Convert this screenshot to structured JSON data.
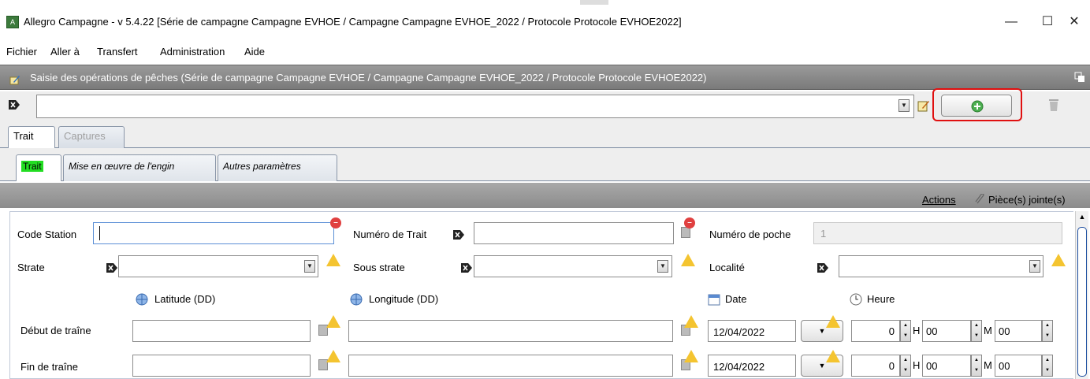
{
  "window": {
    "title": "Allegro Campagne - v 5.4.22 [Série de campagne Campagne EVHOE / Campagne Campagne EVHOE_2022 / Protocole Protocole EVHOE2022]",
    "app_icon_text": "A",
    "minimize": "—",
    "maximize": "☐",
    "close": "✕"
  },
  "menu": [
    "Fichier",
    "Aller à",
    "Transfert",
    "Administration",
    "Aide"
  ],
  "frame": {
    "title": "Saisie des opérations de pêches (Série de campagne Campagne EVHOE / Campagne Campagne EVHOE_2022 / Protocole Protocole EVHOE2022)"
  },
  "selector": {
    "value": "",
    "add_button_icon": "plus-circle-icon",
    "delete_button_icon": "trash-icon"
  },
  "tabs": [
    {
      "label": "Trait",
      "active": true
    },
    {
      "label": "Captures",
      "active": false,
      "disabled": true
    }
  ],
  "subtabs": [
    {
      "label": "Trait",
      "active": true,
      "highlight": "#22dd22"
    },
    {
      "label": "Mise en œuvre de l'engin"
    },
    {
      "label": "Autres paramètres"
    }
  ],
  "actions": {
    "actions_label": "Actions",
    "attachments_label": "Pièce(s) jointe(s)"
  },
  "form": {
    "code_station_label": "Code Station",
    "code_station_value": "",
    "numero_trait_label": "Numéro de Trait",
    "numero_trait_value": "",
    "numero_poche_label": "Numéro de poche",
    "numero_poche_value": "1",
    "strate_label": "Strate",
    "sous_strate_label": "Sous strate",
    "localite_label": "Localité",
    "latitude_label": "Latitude (DD)",
    "longitude_label": "Longitude (DD)",
    "date_label": "Date",
    "heure_label": "Heure",
    "rows": [
      {
        "label": "Début de traîne",
        "latitude": "",
        "longitude": "",
        "date": "12/04/2022",
        "hour": "0",
        "minute": "00",
        "second": "00"
      },
      {
        "label": "Fin de traîne",
        "latitude": "",
        "longitude": "",
        "date": "12/04/2022",
        "hour": "0",
        "minute": "00",
        "second": "00"
      }
    ],
    "hour_unit": "H",
    "minute_unit": "M"
  }
}
